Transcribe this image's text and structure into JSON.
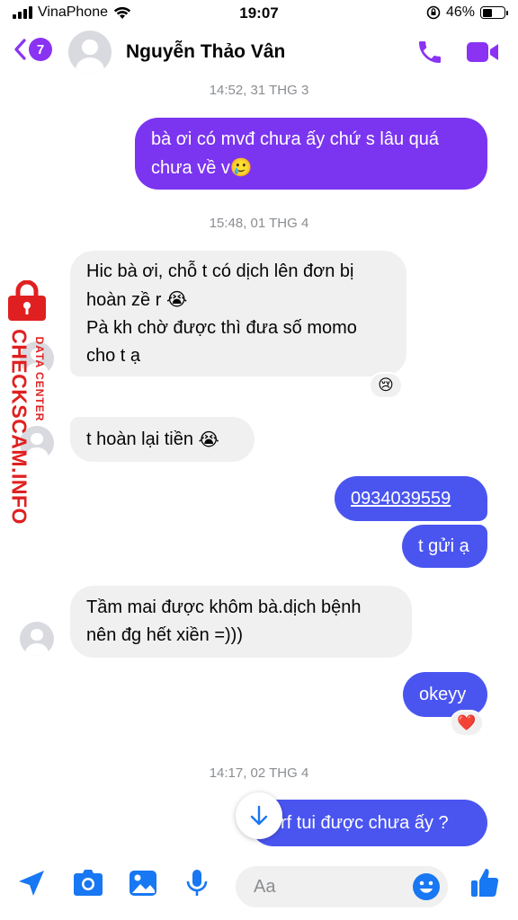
{
  "status_bar": {
    "carrier": "VinaPhone",
    "time": "19:07",
    "battery": "46%",
    "battery_level": 0.46
  },
  "header": {
    "unread_count": "7",
    "contact_name": "Nguyễn Thảo Vân"
  },
  "watermark": {
    "brand": "CHECKSCAM.INFO",
    "tagline": "DATA CENTER"
  },
  "messages": {
    "ts1": "14:52, 31 THG 3",
    "m1_line1": "bà ơi có mvđ chưa ấy chứ s lâu quá",
    "m1_line2": "chưa về v",
    "m1_emoji": "🥲",
    "ts2": "15:48, 01 THG 4",
    "m2_line1": "Hic bà ơi, chỗ t có dịch lên đơn bị",
    "m2_line2": "hoàn zề r",
    "m2_line2_emoji": "😭",
    "m2_line3": "Pà kh chờ được thì đưa số momo",
    "m2_line4": "cho t ạ",
    "m2_reaction": "😢",
    "m3_text": "t hoàn lại tiền",
    "m3_emoji": "😭",
    "m4_text": "0934039559",
    "m5_text": "t gửi ạ",
    "m6_line1": "Tầm mai được khôm bà.dịch bệnh",
    "m6_line2": "nên đg hết xiền =)))",
    "m7_text": "okeyy",
    "m7_reaction": "❤️",
    "ts3": "14:17, 02 THG 4",
    "m8_text": "rf tui được chưa ấy ?"
  },
  "composer": {
    "placeholder": "Aa"
  },
  "colors": {
    "accent": "#8a33f2",
    "outgoing": "#7b35f0",
    "outgoing_recent": "#4a55f0",
    "incoming": "#f0f0f0",
    "watermark": "#e02020"
  },
  "icons": [
    "signal-icon",
    "wifi-icon",
    "orientation-lock-icon",
    "battery-icon",
    "back-chevron-icon",
    "phone-icon",
    "video-icon",
    "arrow-down-icon",
    "send-location-icon",
    "camera-icon",
    "image-icon",
    "microphone-icon",
    "smiley-icon",
    "thumbs-up-icon",
    "lock-icon"
  ]
}
